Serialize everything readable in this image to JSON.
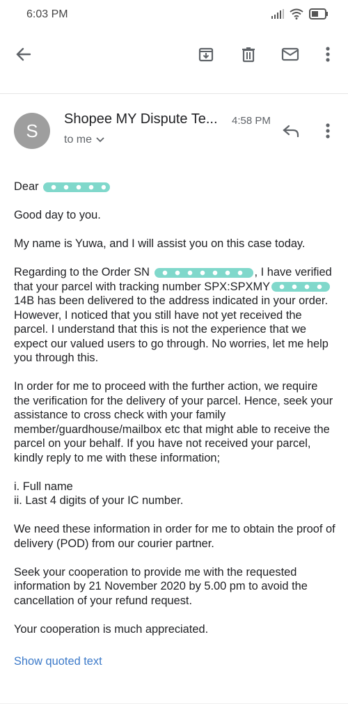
{
  "status_bar": {
    "time": "6:03 PM"
  },
  "toolbar": {
    "icons": [
      "back-arrow-icon",
      "archive-icon",
      "delete-icon",
      "mail-icon",
      "more-vert-icon"
    ]
  },
  "message": {
    "avatar_letter": "S",
    "sender": "Shopee MY Dispute Te...",
    "time": "4:58 PM",
    "recipient": "to me",
    "greeting": "Dear",
    "p1": "Good day to you.",
    "p2": "My name is Yuwa, and I will assist you on this case today.",
    "p3a": "Regarding to the Order SN",
    "p3b": ", I have verified that your parcel with tracking number SPX:SPXMY",
    "p3c": "14B has been delivered to the address indicated in your order. However, I noticed that you still have not yet received the parcel. I understand that this is not the experience that we expect our valued users to go through. No worries, let me help you through this.",
    "p4": "In order for me to proceed with the further action, we require the verification for the delivery of your parcel. Hence, seek your assistance to cross check with your family member/guardhouse/mailbox etc that might able to receive the parcel on your behalf. If you have not received your parcel, kindly reply to me with these information;",
    "list1": "i. Full name",
    "list2": "ii. Last 4 digits of your IC number.",
    "p5": "We need these information in order for me to obtain the proof of delivery (POD) from our courier partner.",
    "p6": "Seek your cooperation to provide me with the requested information by 21 November 2020 by 5.00 pm to avoid the cancellation of your refund request.",
    "p7": "Your cooperation is much appreciated.",
    "show_quoted": "Show quoted text"
  }
}
